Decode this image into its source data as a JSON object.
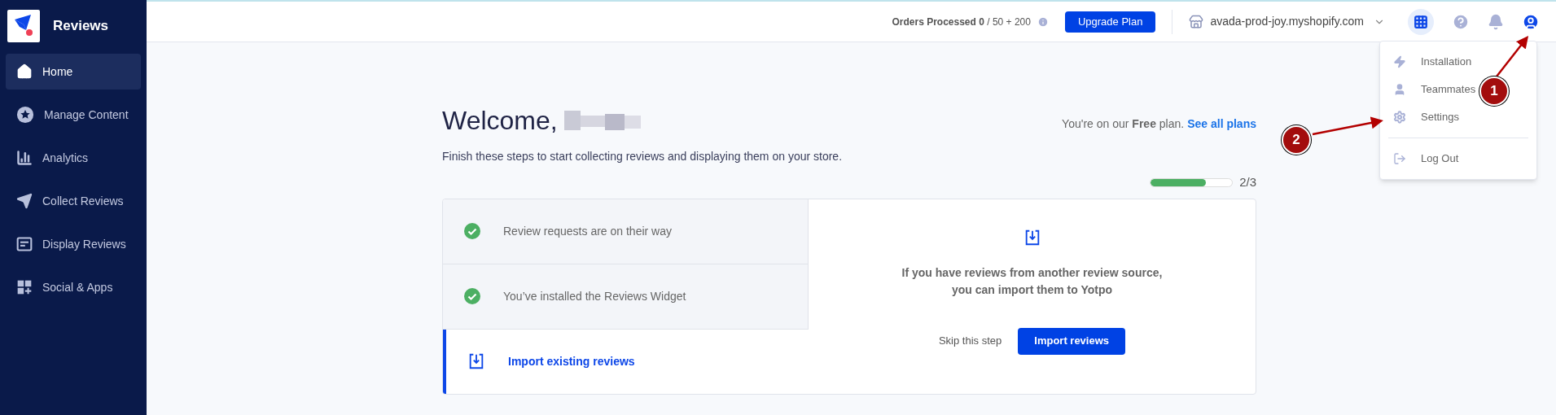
{
  "sidebar": {
    "app_name": "Reviews",
    "items": [
      {
        "label": "Home",
        "selected": true
      },
      {
        "label": "Manage Content",
        "selected": false
      },
      {
        "label": "Analytics",
        "selected": false
      },
      {
        "label": "Collect Reviews",
        "selected": false
      },
      {
        "label": "Display Reviews",
        "selected": false
      },
      {
        "label": "Social & Apps",
        "selected": false
      }
    ]
  },
  "top_bar": {
    "orders": "**Orders Processed 0** / 50 + 200",
    "upgrade_button": "Upgrade Plan",
    "store": "avada-prod-joy.myshopify.com"
  },
  "user_menu": {
    "items": [
      "Installation",
      "Teammates",
      "Settings"
    ],
    "footer_items": [
      "Log Out"
    ]
  },
  "welcome": {
    "title": "Welcome,",
    "subtitle": "Finish these steps to start collecting reviews and displaying them on your store.",
    "plan_text": "You're on our **Free** plan.",
    "plan_link": "See all plans",
    "progress": {
      "level": 0.68,
      "reading": "2/3"
    }
  },
  "steps": [
    {
      "label": "Review requests are on their way",
      "done": true,
      "selected": false
    },
    {
      "label": "You’ve installed the Reviews Widget",
      "done": true,
      "selected": false
    },
    {
      "label": "Import existing reviews",
      "done": false,
      "selected": true
    }
  ],
  "step_detail": {
    "message": "If you have reviews from another review source, you can import them to Yotpo",
    "skip": "Skip this step",
    "action": "Import reviews"
  },
  "annotations": [
    {
      "label": "1"
    },
    {
      "label": "2"
    }
  ]
}
